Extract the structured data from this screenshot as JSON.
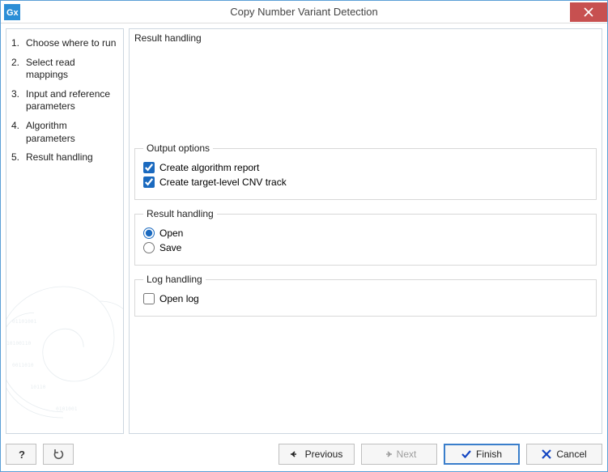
{
  "titlebar": {
    "title": "Copy Number Variant Detection",
    "app_icon": "gx-app-icon",
    "close_icon": "close-icon"
  },
  "sidebar": {
    "items": [
      {
        "num": "1.",
        "label": "Choose where to run"
      },
      {
        "num": "2.",
        "label": "Select read mappings"
      },
      {
        "num": "3.",
        "label": "Input and reference parameters"
      },
      {
        "num": "4.",
        "label": "Algorithm parameters"
      },
      {
        "num": "5.",
        "label": "Result handling"
      }
    ]
  },
  "panel": {
    "title": "Result handling",
    "output": {
      "legend": "Output options",
      "opt1_label": "Create algorithm report",
      "opt1_checked": true,
      "opt2_label": "Create target-level CNV track",
      "opt2_checked": true
    },
    "result": {
      "legend": "Result handling",
      "open_label": "Open",
      "save_label": "Save",
      "selected": "open"
    },
    "log": {
      "legend": "Log handling",
      "open_log_label": "Open log",
      "open_log_checked": false
    }
  },
  "footer": {
    "help_icon": "question-icon",
    "reset_icon": "undo-icon",
    "previous": "Previous",
    "next": "Next",
    "finish": "Finish",
    "cancel": "Cancel",
    "next_enabled": false
  }
}
